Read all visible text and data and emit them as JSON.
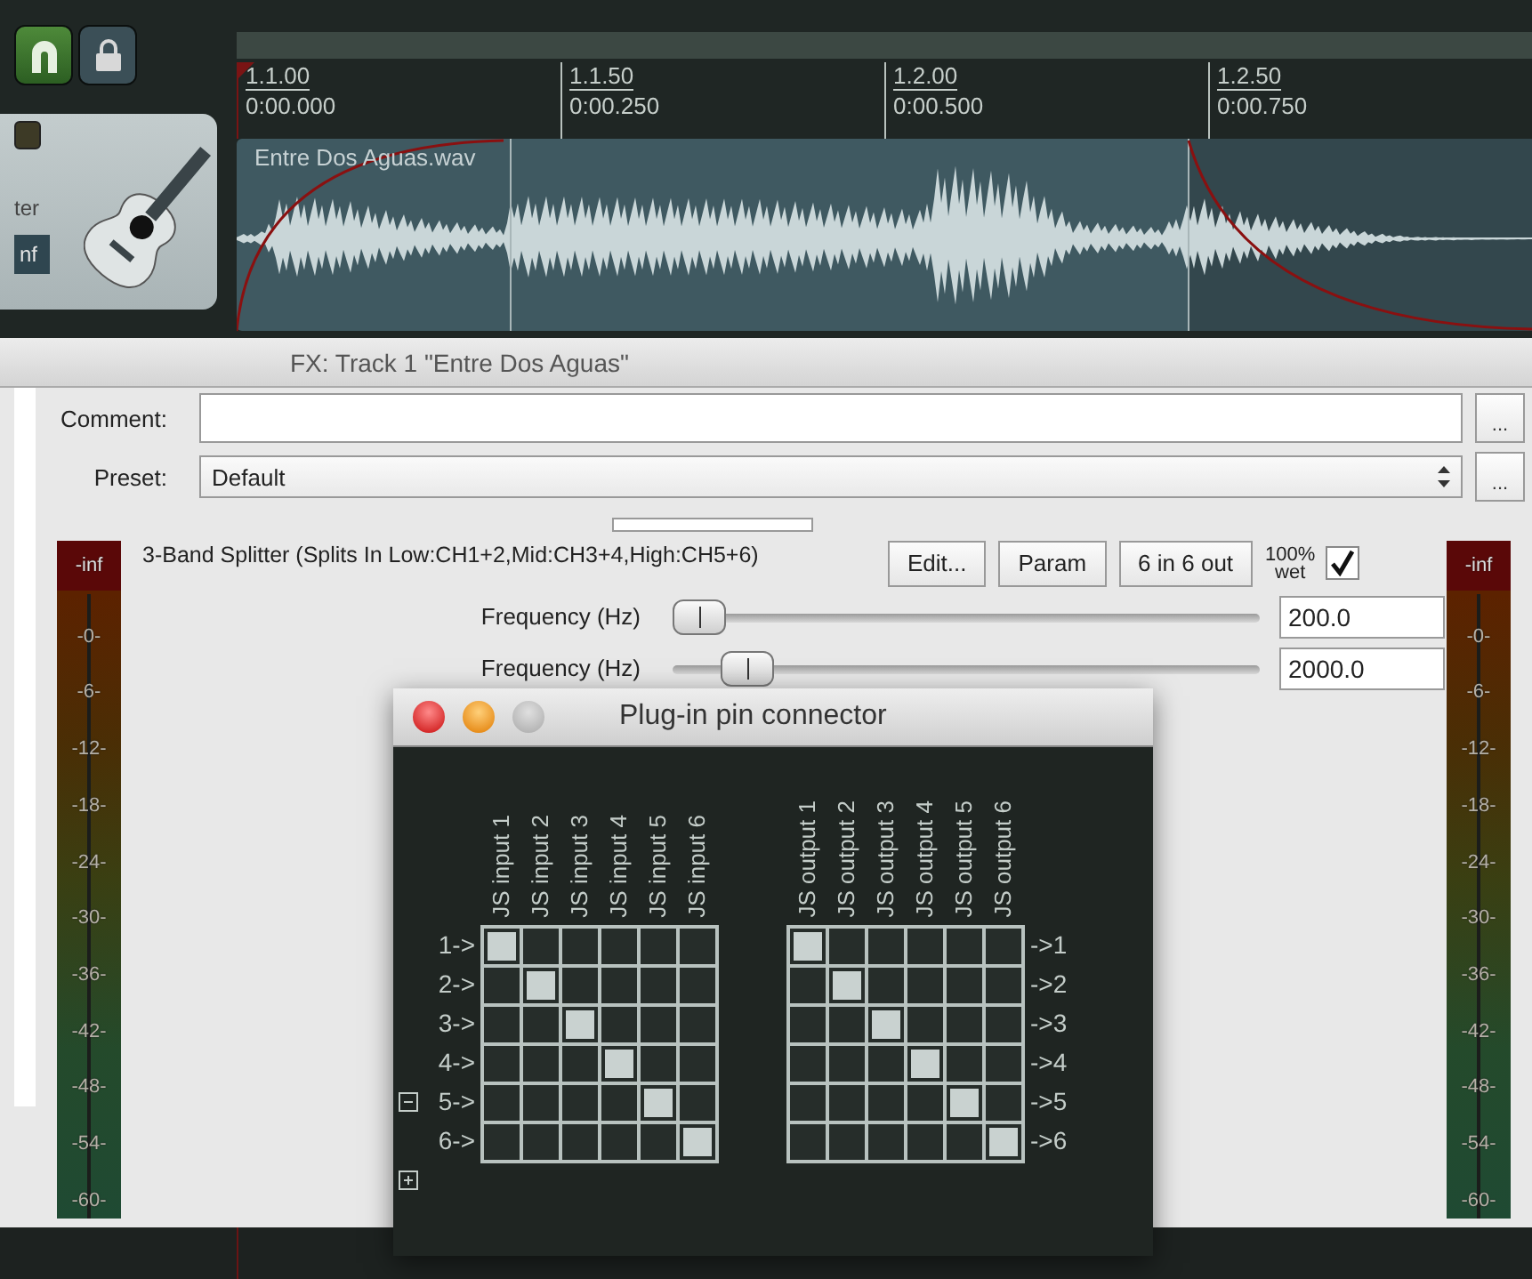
{
  "toolbar": {
    "buttons": [
      {
        "kind": "horseshoe",
        "on": true
      },
      {
        "kind": "lock",
        "on": false
      }
    ]
  },
  "track": {
    "partial_label": "ter",
    "volume_readout": "nf"
  },
  "ruler": [
    {
      "bar": "1.1.00",
      "time": "0:00.000"
    },
    {
      "bar": "1.1.50",
      "time": "0:00.250"
    },
    {
      "bar": "1.2.00",
      "time": "0:00.500"
    },
    {
      "bar": "1.2.50",
      "time": "0:00.750"
    }
  ],
  "clip": {
    "name": "Entre Dos Aguas.wav"
  },
  "fx_window": {
    "title": "FX: Track 1 \"Entre Dos Aguas\"",
    "comment": {
      "label": "Comment:",
      "button": "..."
    },
    "preset": {
      "label": "Preset:",
      "value": "Default",
      "button": "..."
    },
    "input_meter": {
      "labels": [
        "-inf",
        "-0-",
        "-6-",
        "-12-",
        "-18-",
        "-24-",
        "-30-",
        "-36-",
        "-42-",
        "-48-",
        "-54-",
        "-60-"
      ]
    },
    "output_meter": {
      "labels": [
        "-inf",
        "-0-",
        "-6-",
        "-12-",
        "-18-",
        "-24-",
        "-30-",
        "-36-",
        "-42-",
        "-48-",
        "-54-",
        "-60-"
      ]
    },
    "plugin": {
      "name": "3-Band Splitter (Splits In Low:CH1+2,Mid:CH3+4,High:CH5+6)",
      "buttons": [
        "Edit...",
        "Param",
        "6 in 6 out"
      ],
      "wet": "100%",
      "wet_caption": "wet",
      "enabled": true
    },
    "params": [
      {
        "label": "Frequency (Hz)",
        "level": 0.0,
        "value": "200.0"
      },
      {
        "label": "Frequency (Hz)",
        "level": 0.09,
        "value": "2000.0"
      }
    ]
  },
  "pin_connector": {
    "title": "Plug-in pin connector",
    "inputs": {
      "columns": [
        "JS input 1",
        "JS input 2",
        "JS input 3",
        "JS input 4",
        "JS input 5",
        "JS input 6"
      ],
      "rows": [
        {
          "label": "1->",
          "pins": [
            true,
            false,
            false,
            false,
            false,
            false
          ]
        },
        {
          "label": "2->",
          "pins": [
            false,
            true,
            false,
            false,
            false,
            false
          ]
        },
        {
          "label": "3->",
          "pins": [
            false,
            false,
            true,
            false,
            false,
            false
          ]
        },
        {
          "label": "4->",
          "pins": [
            false,
            false,
            false,
            true,
            false,
            false
          ]
        },
        {
          "label": "5->",
          "pins": [
            false,
            false,
            false,
            false,
            true,
            false
          ]
        },
        {
          "label": "6->",
          "pins": [
            false,
            false,
            false,
            false,
            false,
            true
          ]
        }
      ]
    },
    "outputs": {
      "columns": [
        "JS output 1",
        "JS output 2",
        "JS output 3",
        "JS output 4",
        "JS output 5",
        "JS output 6"
      ],
      "rows": [
        {
          "label": "->1",
          "pins": [
            true,
            false,
            false,
            false,
            false,
            false
          ]
        },
        {
          "label": "->2",
          "pins": [
            false,
            true,
            false,
            false,
            false,
            false
          ]
        },
        {
          "label": "->3",
          "pins": [
            false,
            false,
            true,
            false,
            false,
            false
          ]
        },
        {
          "label": "->4",
          "pins": [
            false,
            false,
            false,
            true,
            false,
            false
          ]
        },
        {
          "label": "->5",
          "pins": [
            false,
            false,
            false,
            false,
            true,
            false
          ]
        },
        {
          "label": "->6",
          "pins": [
            false,
            false,
            false,
            false,
            false,
            true
          ]
        }
      ]
    }
  }
}
